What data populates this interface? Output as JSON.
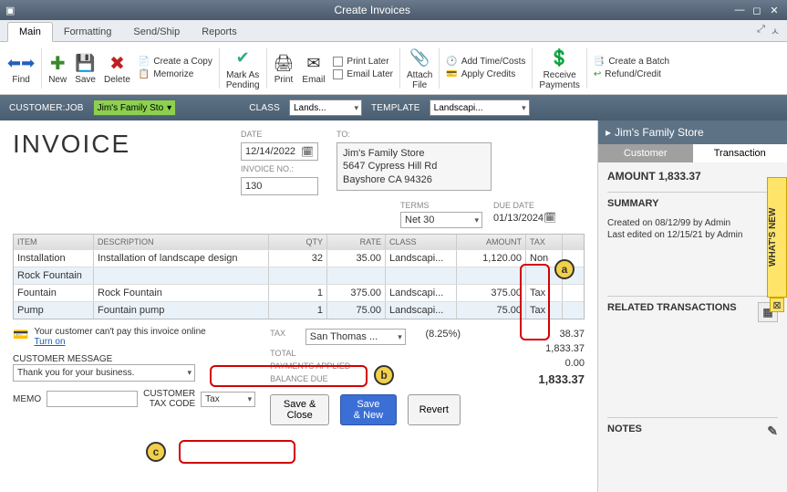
{
  "window": {
    "title": "Create Invoices"
  },
  "tabs": {
    "items": [
      "Main",
      "Formatting",
      "Send/Ship",
      "Reports"
    ],
    "active": 0
  },
  "ribbon": {
    "find": "Find",
    "new": "New",
    "save": "Save",
    "delete": "Delete",
    "create_copy": "Create a Copy",
    "memorize": "Memorize",
    "mark_pending": "Mark As\nPending",
    "print": "Print",
    "email": "Email",
    "print_later": "Print Later",
    "email_later": "Email Later",
    "attach_file": "Attach\nFile",
    "add_time": "Add Time/Costs",
    "apply_credits": "Apply Credits",
    "receive_payments": "Receive\nPayments",
    "create_batch": "Create a Batch",
    "refund_credit": "Refund/Credit"
  },
  "jobbar": {
    "customer_label": "CUSTOMER:JOB",
    "customer_value": "Jim's Family Sto",
    "class_label": "CLASS",
    "class_value": "Lands...",
    "template_label": "TEMPLATE",
    "template_value": "Landscapi..."
  },
  "invoice": {
    "heading": "INVOICE",
    "date_label": "DATE",
    "date": "12/14/2022",
    "no_label": "INVOICE NO.:",
    "no": "130",
    "to_label": "TO:",
    "to_name": "Jim's Family Store",
    "to_addr1": "5647 Cypress Hill Rd",
    "to_addr2": "Bayshore CA 94326",
    "terms_label": "TERMS",
    "terms": "Net 30",
    "due_label": "DUE DATE",
    "due": "01/13/2024"
  },
  "grid": {
    "headers": {
      "item": "ITEM",
      "desc": "DESCRIPTION",
      "qty": "QTY",
      "rate": "RATE",
      "class": "CLASS",
      "amount": "AMOUNT",
      "tax": "TAX"
    },
    "rows": [
      {
        "item": "Installation",
        "desc": "Installation of landscape design",
        "qty": "32",
        "rate": "35.00",
        "class": "Landscapi...",
        "amount": "1,120.00",
        "tax": "Non"
      },
      {
        "item": "Rock Fountain",
        "desc": "",
        "qty": "",
        "rate": "",
        "class": "",
        "amount": "",
        "tax": ""
      },
      {
        "item": "Fountain",
        "desc": "Rock Fountain",
        "qty": "1",
        "rate": "375.00",
        "class": "Landscapi...",
        "amount": "375.00",
        "tax": "Tax"
      },
      {
        "item": "Pump",
        "desc": "Fountain pump",
        "qty": "1",
        "rate": "75.00",
        "class": "Landscapi...",
        "amount": "75.00",
        "tax": "Tax"
      }
    ]
  },
  "footer": {
    "online_msg": "Your customer can't pay this invoice online",
    "turn_on": "Turn on",
    "cust_msg_label": "CUSTOMER MESSAGE",
    "cust_msg": "Thank you for your business.",
    "memo_label": "MEMO",
    "memo": "",
    "cust_tax_label": "CUSTOMER\nTAX CODE",
    "cust_tax": "Tax",
    "tax_label": "TAX",
    "tax_item": "San Thomas ...",
    "tax_rate": "(8.25%)",
    "tax_amount": "38.37",
    "total_label": "TOTAL",
    "total": "1,833.37",
    "paid_label": "PAYMENTS APPLIED",
    "paid": "0.00",
    "balance_label": "BALANCE DUE",
    "balance": "1,833.37",
    "save_close": "Save & Close",
    "save_new": "Save & New",
    "revert": "Revert"
  },
  "side": {
    "title": "Jim's Family Store",
    "tab_customer": "Customer",
    "tab_transaction": "Transaction",
    "amount_label": "AMOUNT",
    "amount": "1,833.37",
    "summary": "SUMMARY",
    "created": "Created on 08/12/99  by  Admin",
    "edited": "Last edited on 12/15/21 by Admin",
    "related": "RELATED TRANSACTIONS",
    "notes": "NOTES"
  },
  "whatsnew": "WHAT'S NEW",
  "callouts": {
    "a": "a",
    "b": "b",
    "c": "c"
  }
}
